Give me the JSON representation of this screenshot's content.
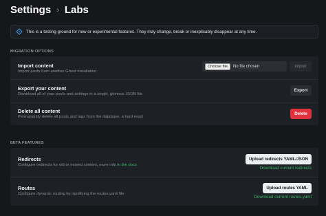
{
  "header": {
    "breadcrumb_root": "Settings",
    "separator": "›",
    "current": "Labs"
  },
  "notice": {
    "text": "This is a testing ground for new or experimental features. They may change, break or inexplicably disappear at any time."
  },
  "migration": {
    "section_title": "MIGRATION OPTIONS",
    "import": {
      "title": "Import content",
      "description": "Import posts from another Ghost installation",
      "choose_file_label": "Choose file",
      "file_status": "No file chosen",
      "button": "Import"
    },
    "export": {
      "title": "Export your content",
      "description": "Download all of your posts and settings in a single, glorious JSON file",
      "button": "Export"
    },
    "delete": {
      "title": "Delete all content",
      "description": "Permanently delete all posts and tags from the database, a hard reset",
      "button": "Delete"
    }
  },
  "beta": {
    "section_title": "BETA FEATURES",
    "redirects": {
      "title": "Redirects",
      "description": "Configure redirects for old or moved content, more info",
      "description_link": "in the docs",
      "button": "Upload redirects YAML/JSON",
      "download_link": "Download current redirects"
    },
    "routes": {
      "title": "Routes",
      "description": "Configure dynamic routing by modifying the routes.yaml file",
      "button": "Upload routes YAML",
      "download_link": "Download current routes.yaml"
    }
  },
  "colors": {
    "accent_green": "#3eb86b",
    "danger_red": "#e0313c",
    "background": "#15171a"
  }
}
